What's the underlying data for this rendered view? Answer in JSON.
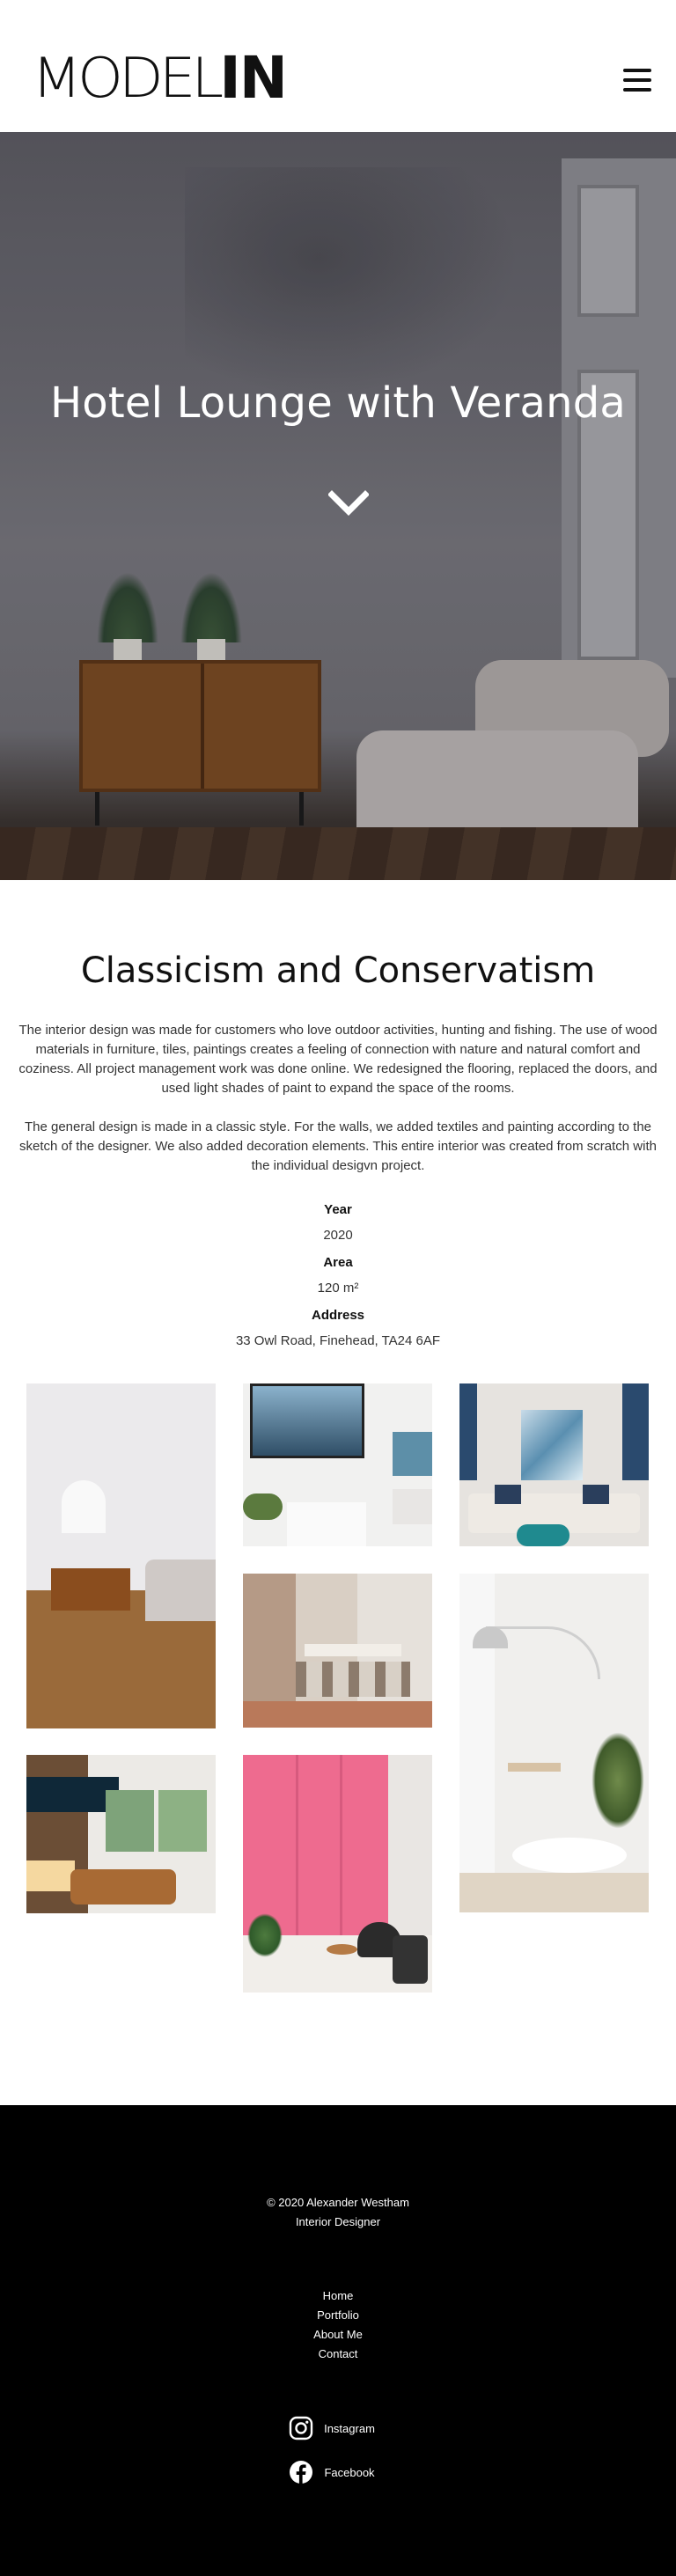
{
  "header": {
    "logo_thin": "MODEL",
    "logo_bold": "IN",
    "menu_icon": "hamburger-menu-icon"
  },
  "hero": {
    "title": "Hotel Lounge with Veranda",
    "scroll_icon": "chevron-down-icon"
  },
  "project": {
    "title": "Classicism and Conservatism",
    "paragraphs": [
      "The interior design was made for customers who love outdoor activities, hunting and fishing. The use of wood materials in furniture, tiles, paintings creates a feeling of connection with nature and natural comfort and coziness. All project management work was done online. We redesigned the flooring, replaced the doors, and used light shades of paint to expand the space of the rooms.",
      "The general design is made in a classic style. For the walls, we added textiles and painting according to the sketch of the designer. We also added decoration elements. This entire interior was created from scratch with the individual desigvn project."
    ],
    "year_label": "Year",
    "year_value": "2020",
    "area_label": "Area",
    "area_value": "120 m²",
    "address_label": "Address",
    "address_value": "33 Owl Road, Finehead, TA24 6AF"
  },
  "footer": {
    "copyright": "© 2020 Alexander Westham",
    "role": "Interior Designer",
    "nav": [
      "Home",
      "Portfolio",
      "About Me",
      "Contact"
    ],
    "social": [
      {
        "label": "Instagram",
        "icon": "instagram-icon"
      },
      {
        "label": "Facebook",
        "icon": "facebook-icon"
      }
    ],
    "background": "#000000"
  }
}
